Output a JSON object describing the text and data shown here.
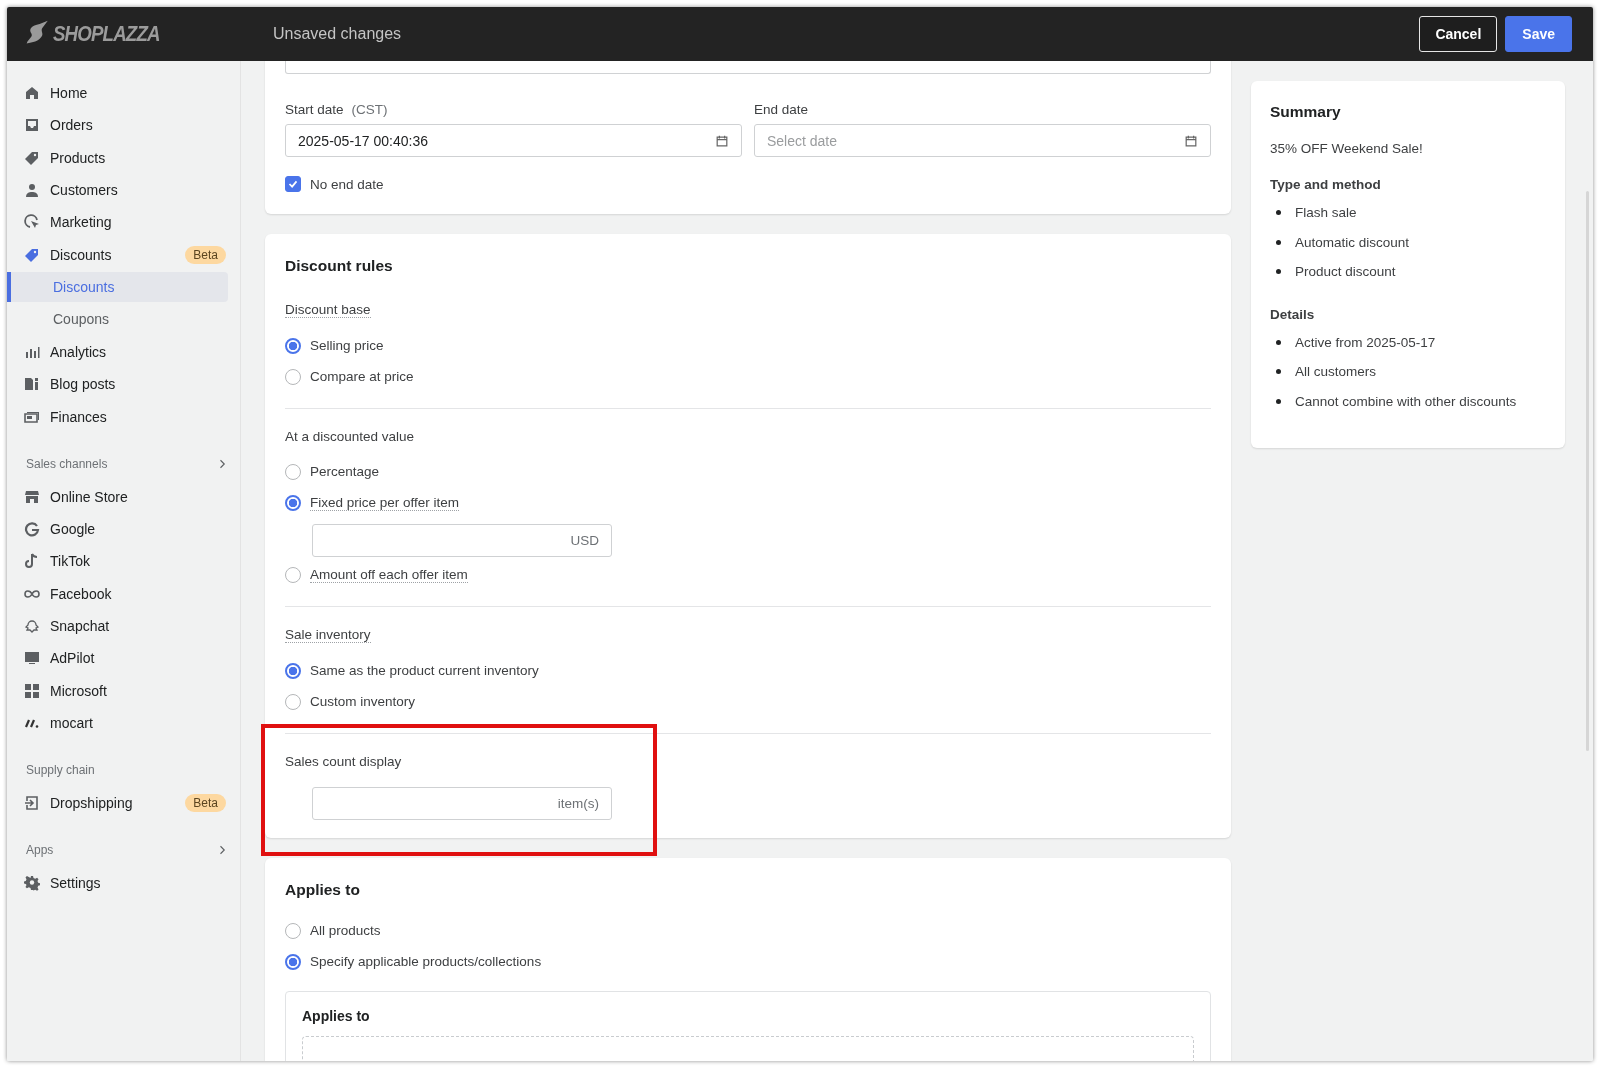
{
  "topbar": {
    "logo": "SHOPLAZZA",
    "title": "Unsaved changes",
    "buttons": [
      {
        "label": "Cancel",
        "kind": "secondary"
      },
      {
        "label": "Save",
        "kind": "primary"
      }
    ]
  },
  "sidebar": {
    "items": [
      {
        "kind": "item",
        "label": "Home"
      },
      {
        "kind": "item",
        "label": "Orders"
      },
      {
        "kind": "item",
        "label": "Products"
      },
      {
        "kind": "item",
        "label": "Customers"
      },
      {
        "kind": "item",
        "label": "Marketing"
      },
      {
        "kind": "item",
        "label": "Discounts",
        "badge": "Beta"
      },
      {
        "kind": "sub",
        "label": "Discounts",
        "selected": true
      },
      {
        "kind": "sub",
        "label": "Coupons",
        "selected": false
      },
      {
        "kind": "item",
        "label": "Analytics"
      },
      {
        "kind": "item",
        "label": "Blog posts"
      },
      {
        "kind": "item",
        "label": "Finances"
      },
      {
        "kind": "section",
        "label": "Sales channels",
        "expandable": true
      },
      {
        "kind": "item",
        "label": "Online Store"
      },
      {
        "kind": "item",
        "label": "Google"
      },
      {
        "kind": "item",
        "label": "TikTok"
      },
      {
        "kind": "item",
        "label": "Facebook"
      },
      {
        "kind": "item",
        "label": "Snapchat"
      },
      {
        "kind": "item",
        "label": "AdPilot"
      },
      {
        "kind": "item",
        "label": "Microsoft"
      },
      {
        "kind": "item",
        "label": "mocart"
      },
      {
        "kind": "section",
        "label": "Supply chain",
        "expandable": false
      },
      {
        "kind": "item",
        "label": "Dropshipping",
        "badge": "Beta"
      },
      {
        "kind": "section",
        "label": "Apps",
        "expandable": true
      },
      {
        "kind": "item",
        "label": "Settings"
      }
    ]
  },
  "schedule": {
    "start": {
      "label": "Start date",
      "note": "(CST)",
      "value": "2025-05-17 00:40:36"
    },
    "end": {
      "label": "End date",
      "placeholder": "Select date"
    },
    "no_end_date": {
      "label": "No end date",
      "checked": true
    }
  },
  "discount_rules": {
    "title": "Discount rules",
    "groups": [
      {
        "label": "Discount base",
        "dotted": true,
        "options": [
          {
            "label": "Selling price",
            "selected": true,
            "dotted": false
          },
          {
            "label": "Compare at price",
            "selected": false,
            "dotted": false
          }
        ]
      },
      {
        "label": "At a discounted value",
        "dotted": false,
        "options": [
          {
            "label": "Percentage",
            "selected": false,
            "dotted": false
          },
          {
            "label": "Fixed price per offer item",
            "selected": true,
            "dotted": true,
            "field": {
              "suffix": "USD"
            }
          },
          {
            "label": "Amount off each offer item",
            "selected": false,
            "dotted": true
          }
        ]
      },
      {
        "label": "Sale inventory",
        "dotted": true,
        "options": [
          {
            "label": "Same as the product current inventory",
            "selected": true,
            "dotted": false
          },
          {
            "label": "Custom inventory",
            "selected": false,
            "dotted": false
          }
        ]
      },
      {
        "label": "Sales count display",
        "dotted": false,
        "highlighted": true,
        "field": {
          "suffix": "item(s)"
        }
      }
    ]
  },
  "applies_to": {
    "title": "Applies to",
    "options": [
      {
        "label": "All products",
        "selected": false
      },
      {
        "label": "Specify applicable products/collections",
        "selected": true
      }
    ],
    "panel": {
      "title": "Applies to"
    }
  },
  "summary": {
    "title": "Summary",
    "name": "35% OFF Weekend Sale!",
    "sections": [
      {
        "title": "Type and method",
        "items": [
          "Flash sale",
          "Automatic discount",
          "Product discount"
        ]
      },
      {
        "title": "Details",
        "items": [
          "Active from 2025-05-17",
          "All customers",
          "Cannot combine with other discounts"
        ]
      }
    ]
  }
}
